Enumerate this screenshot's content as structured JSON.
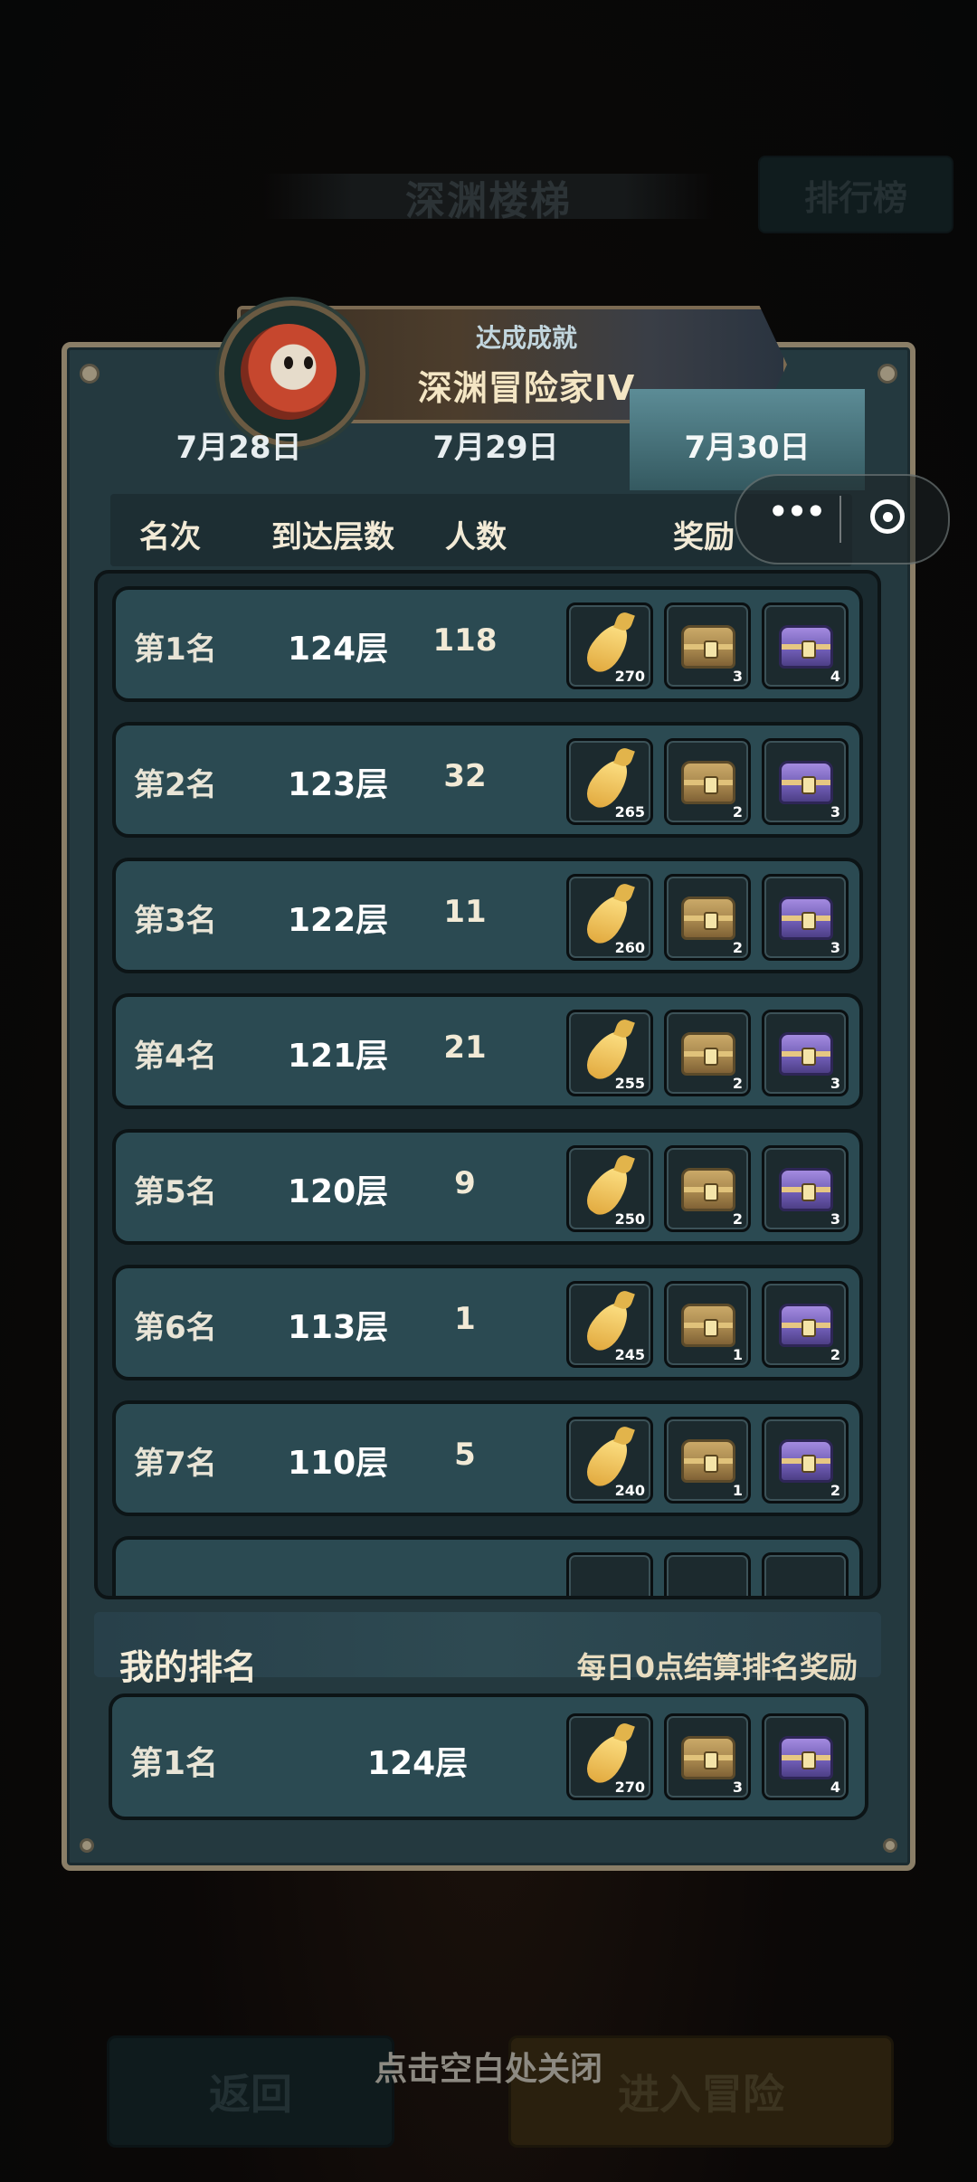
{
  "background": {
    "title": "深渊楼梯",
    "rank_button": "排行榜",
    "back_button": "返回",
    "enter_button": "进入冒险",
    "close_hint": "点击空白处关闭"
  },
  "achievement": {
    "subtitle": "达成成就",
    "title": "深渊冒险家IV"
  },
  "tabs": [
    {
      "label": "7月28日",
      "selected": false
    },
    {
      "label": "7月29日",
      "selected": false
    },
    {
      "label": "7月30日",
      "selected": true
    }
  ],
  "columns": [
    "名次",
    "到达层数",
    "人数",
    "奖励"
  ],
  "rows": [
    {
      "rank": "第1名",
      "floor": "124层",
      "count": "118",
      "rewards": [
        "270",
        "3",
        "4"
      ]
    },
    {
      "rank": "第2名",
      "floor": "123层",
      "count": "32",
      "rewards": [
        "265",
        "2",
        "3"
      ]
    },
    {
      "rank": "第3名",
      "floor": "122层",
      "count": "11",
      "rewards": [
        "260",
        "2",
        "3"
      ]
    },
    {
      "rank": "第4名",
      "floor": "121层",
      "count": "21",
      "rewards": [
        "255",
        "2",
        "3"
      ]
    },
    {
      "rank": "第5名",
      "floor": "120层",
      "count": "9",
      "rewards": [
        "250",
        "2",
        "3"
      ]
    },
    {
      "rank": "第6名",
      "floor": "113层",
      "count": "1",
      "rewards": [
        "245",
        "1",
        "2"
      ]
    },
    {
      "rank": "第7名",
      "floor": "110层",
      "count": "5",
      "rewards": [
        "240",
        "1",
        "2"
      ]
    }
  ],
  "reward_icons": [
    "carrot-icon",
    "gold-chest-icon",
    "purple-chest-icon"
  ],
  "my_rank": {
    "title": "我的排名",
    "note": "每日0点结算排名奖励",
    "rank": "第1名",
    "floor": "124层",
    "rewards": [
      "270",
      "3",
      "4"
    ]
  },
  "colors": {
    "panel": "#24393f",
    "row": "#2b4a52",
    "border": "#8a7e67",
    "selected_tab": "#5c8c96"
  }
}
